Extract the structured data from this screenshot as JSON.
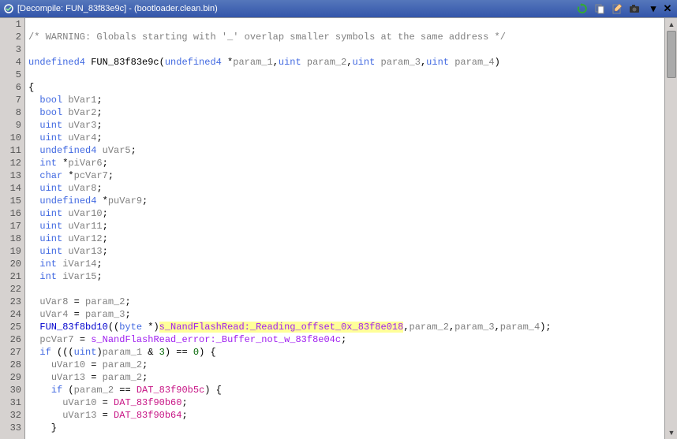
{
  "titlebar": {
    "title": "[Decompile: FUN_83f83e9c] - (bootloader.clean.bin)"
  },
  "code": {
    "lines": [
      {
        "n": 1,
        "segs": []
      },
      {
        "n": 2,
        "segs": [
          {
            "cls": "c-comment",
            "t": "/* WARNING: Globals starting with '_' overlap smaller symbols at the same address */"
          }
        ]
      },
      {
        "n": 3,
        "segs": []
      },
      {
        "n": 4,
        "segs": [
          {
            "cls": "c-type",
            "t": "undefined4"
          },
          {
            "t": " "
          },
          {
            "cls": "c-func",
            "t": "FUN_83f83e9c"
          },
          {
            "t": "("
          },
          {
            "cls": "c-type",
            "t": "undefined4"
          },
          {
            "t": " *"
          },
          {
            "cls": "c-param",
            "t": "param_1"
          },
          {
            "t": ","
          },
          {
            "cls": "c-type",
            "t": "uint"
          },
          {
            "t": " "
          },
          {
            "cls": "c-param",
            "t": "param_2"
          },
          {
            "t": ","
          },
          {
            "cls": "c-type",
            "t": "uint"
          },
          {
            "t": " "
          },
          {
            "cls": "c-param",
            "t": "param_3"
          },
          {
            "t": ","
          },
          {
            "cls": "c-type",
            "t": "uint"
          },
          {
            "t": " "
          },
          {
            "cls": "c-param",
            "t": "param_4"
          },
          {
            "t": ")"
          }
        ]
      },
      {
        "n": 5,
        "segs": []
      },
      {
        "n": 6,
        "segs": [
          {
            "t": "{"
          }
        ]
      },
      {
        "n": 7,
        "segs": [
          {
            "t": "  "
          },
          {
            "cls": "c-type",
            "t": "bool"
          },
          {
            "t": " "
          },
          {
            "cls": "c-var",
            "t": "bVar1"
          },
          {
            "t": ";"
          }
        ]
      },
      {
        "n": 8,
        "segs": [
          {
            "t": "  "
          },
          {
            "cls": "c-type",
            "t": "bool"
          },
          {
            "t": " "
          },
          {
            "cls": "c-var",
            "t": "bVar2"
          },
          {
            "t": ";"
          }
        ]
      },
      {
        "n": 9,
        "segs": [
          {
            "t": "  "
          },
          {
            "cls": "c-type",
            "t": "uint"
          },
          {
            "t": " "
          },
          {
            "cls": "c-var",
            "t": "uVar3"
          },
          {
            "t": ";"
          }
        ]
      },
      {
        "n": 10,
        "segs": [
          {
            "t": "  "
          },
          {
            "cls": "c-type",
            "t": "uint"
          },
          {
            "t": " "
          },
          {
            "cls": "c-var",
            "t": "uVar4"
          },
          {
            "t": ";"
          }
        ]
      },
      {
        "n": 11,
        "segs": [
          {
            "t": "  "
          },
          {
            "cls": "c-type",
            "t": "undefined4"
          },
          {
            "t": " "
          },
          {
            "cls": "c-var",
            "t": "uVar5"
          },
          {
            "t": ";"
          }
        ]
      },
      {
        "n": 12,
        "segs": [
          {
            "t": "  "
          },
          {
            "cls": "c-type",
            "t": "int"
          },
          {
            "t": " *"
          },
          {
            "cls": "c-var",
            "t": "piVar6"
          },
          {
            "t": ";"
          }
        ]
      },
      {
        "n": 13,
        "segs": [
          {
            "t": "  "
          },
          {
            "cls": "c-type",
            "t": "char"
          },
          {
            "t": " *"
          },
          {
            "cls": "c-var",
            "t": "pcVar7"
          },
          {
            "t": ";"
          }
        ]
      },
      {
        "n": 14,
        "segs": [
          {
            "t": "  "
          },
          {
            "cls": "c-type",
            "t": "uint"
          },
          {
            "t": " "
          },
          {
            "cls": "c-var",
            "t": "uVar8"
          },
          {
            "t": ";"
          }
        ]
      },
      {
        "n": 15,
        "segs": [
          {
            "t": "  "
          },
          {
            "cls": "c-type",
            "t": "undefined4"
          },
          {
            "t": " *"
          },
          {
            "cls": "c-var",
            "t": "puVar9"
          },
          {
            "t": ";"
          }
        ]
      },
      {
        "n": 16,
        "segs": [
          {
            "t": "  "
          },
          {
            "cls": "c-type",
            "t": "uint"
          },
          {
            "t": " "
          },
          {
            "cls": "c-var",
            "t": "uVar10"
          },
          {
            "t": ";"
          }
        ]
      },
      {
        "n": 17,
        "segs": [
          {
            "t": "  "
          },
          {
            "cls": "c-type",
            "t": "uint"
          },
          {
            "t": " "
          },
          {
            "cls": "c-var",
            "t": "uVar11"
          },
          {
            "t": ";"
          }
        ]
      },
      {
        "n": 18,
        "segs": [
          {
            "t": "  "
          },
          {
            "cls": "c-type",
            "t": "uint"
          },
          {
            "t": " "
          },
          {
            "cls": "c-var",
            "t": "uVar12"
          },
          {
            "t": ";"
          }
        ]
      },
      {
        "n": 19,
        "segs": [
          {
            "t": "  "
          },
          {
            "cls": "c-type",
            "t": "uint"
          },
          {
            "t": " "
          },
          {
            "cls": "c-var",
            "t": "uVar13"
          },
          {
            "t": ";"
          }
        ]
      },
      {
        "n": 20,
        "segs": [
          {
            "t": "  "
          },
          {
            "cls": "c-type",
            "t": "int"
          },
          {
            "t": " "
          },
          {
            "cls": "c-var",
            "t": "iVar14"
          },
          {
            "t": ";"
          }
        ]
      },
      {
        "n": 21,
        "segs": [
          {
            "t": "  "
          },
          {
            "cls": "c-type",
            "t": "int"
          },
          {
            "t": " "
          },
          {
            "cls": "c-var",
            "t": "iVar15"
          },
          {
            "t": ";"
          }
        ]
      },
      {
        "n": 22,
        "segs": [
          {
            "t": "  "
          }
        ]
      },
      {
        "n": 23,
        "segs": [
          {
            "t": "  "
          },
          {
            "cls": "c-var",
            "t": "uVar8"
          },
          {
            "t": " = "
          },
          {
            "cls": "c-param",
            "t": "param_2"
          },
          {
            "t": ";"
          }
        ]
      },
      {
        "n": 24,
        "segs": [
          {
            "t": "  "
          },
          {
            "cls": "c-var",
            "t": "uVar4"
          },
          {
            "t": " = "
          },
          {
            "cls": "c-param",
            "t": "param_3"
          },
          {
            "t": ";"
          }
        ]
      },
      {
        "n": 25,
        "segs": [
          {
            "t": "  "
          },
          {
            "cls": "c-call",
            "t": "FUN_83f8bd10"
          },
          {
            "t": "(("
          },
          {
            "cls": "c-type",
            "t": "byte"
          },
          {
            "t": " *)"
          },
          {
            "cls": "c-string hl",
            "t": "s_NandFlashRead:_Reading_offset_0x_83f8e018"
          },
          {
            "t": ","
          },
          {
            "cls": "c-param",
            "t": "param_2"
          },
          {
            "t": ","
          },
          {
            "cls": "c-param",
            "t": "param_3"
          },
          {
            "t": ","
          },
          {
            "cls": "c-param",
            "t": "param_4"
          },
          {
            "t": ");"
          }
        ]
      },
      {
        "n": 26,
        "segs": [
          {
            "t": "  "
          },
          {
            "cls": "c-var",
            "t": "pcVar7"
          },
          {
            "t": " = "
          },
          {
            "cls": "c-string",
            "t": "s_NandFlashRead_error:_Buffer_not_w_83f8e04c"
          },
          {
            "t": ";"
          }
        ]
      },
      {
        "n": 27,
        "segs": [
          {
            "t": "  "
          },
          {
            "cls": "c-keyword",
            "t": "if"
          },
          {
            "t": " ((("
          },
          {
            "cls": "c-type",
            "t": "uint"
          },
          {
            "t": ")"
          },
          {
            "cls": "c-param",
            "t": "param_1"
          },
          {
            "t": " & "
          },
          {
            "cls": "c-number",
            "t": "3"
          },
          {
            "t": ") == "
          },
          {
            "cls": "c-number",
            "t": "0"
          },
          {
            "t": ") {"
          }
        ]
      },
      {
        "n": 28,
        "segs": [
          {
            "t": "    "
          },
          {
            "cls": "c-var",
            "t": "uVar10"
          },
          {
            "t": " = "
          },
          {
            "cls": "c-param",
            "t": "param_2"
          },
          {
            "t": ";"
          }
        ]
      },
      {
        "n": 29,
        "segs": [
          {
            "t": "    "
          },
          {
            "cls": "c-var",
            "t": "uVar13"
          },
          {
            "t": " = "
          },
          {
            "cls": "c-param",
            "t": "param_2"
          },
          {
            "t": ";"
          }
        ]
      },
      {
        "n": 30,
        "segs": [
          {
            "t": "    "
          },
          {
            "cls": "c-keyword",
            "t": "if"
          },
          {
            "t": " ("
          },
          {
            "cls": "c-param",
            "t": "param_2"
          },
          {
            "t": " == "
          },
          {
            "cls": "c-global",
            "t": "DAT_83f90b5c"
          },
          {
            "t": ") {"
          }
        ]
      },
      {
        "n": 31,
        "segs": [
          {
            "t": "      "
          },
          {
            "cls": "c-var",
            "t": "uVar10"
          },
          {
            "t": " = "
          },
          {
            "cls": "c-global",
            "t": "DAT_83f90b60"
          },
          {
            "t": ";"
          }
        ]
      },
      {
        "n": 32,
        "segs": [
          {
            "t": "      "
          },
          {
            "cls": "c-var",
            "t": "uVar13"
          },
          {
            "t": " = "
          },
          {
            "cls": "c-global",
            "t": "DAT_83f90b64"
          },
          {
            "t": ";"
          }
        ]
      },
      {
        "n": 33,
        "segs": [
          {
            "t": "    }"
          }
        ]
      }
    ]
  }
}
